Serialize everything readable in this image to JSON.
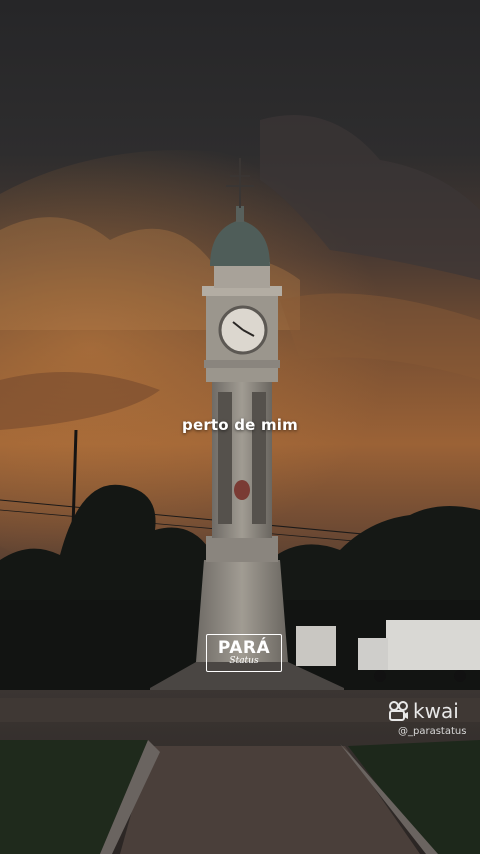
{
  "caption": {
    "text": "perto de mim"
  },
  "brand": {
    "main": "PARÁ",
    "sub": "Status"
  },
  "watermark": {
    "name": "kwai",
    "handle": "@_parastatus"
  },
  "colors": {
    "sky_top": "#2b2b2d",
    "sunset_orange": "#9a5a2a",
    "tree_dark": "#141714",
    "tower_stone": "#8d8a83",
    "pavement": "#3a3330",
    "grass": "#1f2a1c"
  }
}
